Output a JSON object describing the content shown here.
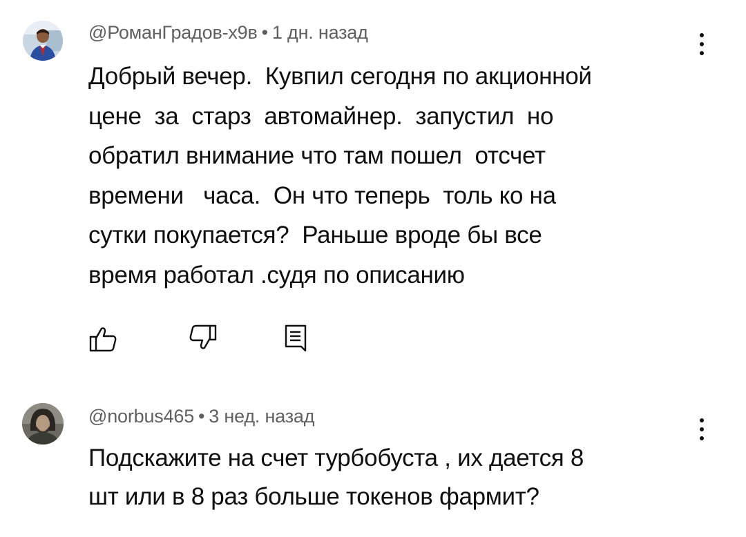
{
  "comments": [
    {
      "author": "@РоманГрадов-х9в",
      "separator": "•",
      "time": "1 дн. назад",
      "text": "Добрый вечер.  Кувпил сегодня по акционной\nцене  за  старз  автомайнер.  запустил  но\nобратил внимание что там пошел  отсчет\nвремени   часа.  Он что теперь  толь ко на\nсутки покупается?  Раньше вроде бы все\nвремя работал .судя по описанию",
      "avatar_icon": "user-avatar-photo"
    },
    {
      "author": "@norbus465",
      "separator": "•",
      "time": "3 нед. назад",
      "text": "Подскажите на счет турбобуста , их дается 8\nшт или в 8 раз больше токенов фармит?",
      "avatar_icon": "user-avatar-photo"
    }
  ],
  "icons": {
    "like": "thumbs-up-icon",
    "dislike": "thumbs-down-icon",
    "reply": "reply-comment-icon",
    "more": "more-vertical-icon"
  },
  "colors": {
    "text": "#0f0f0f",
    "meta": "#606060",
    "background": "#ffffff"
  }
}
